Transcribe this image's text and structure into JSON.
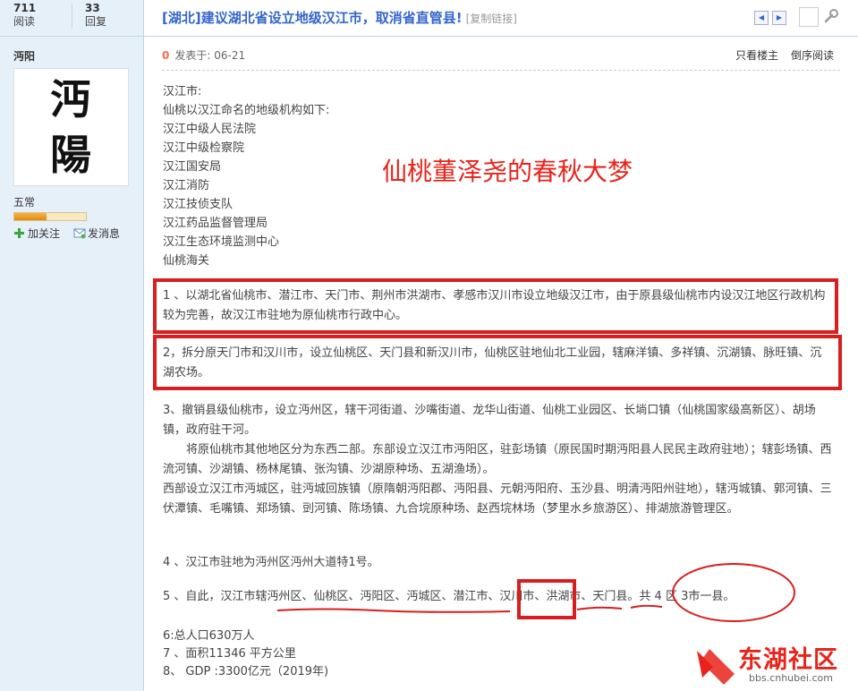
{
  "stats": {
    "views_num": "711",
    "views_label": "阅读",
    "replies_num": "33",
    "replies_label": "回复"
  },
  "author": {
    "name": "沔阳",
    "rank": "五常",
    "rank_progress": 0.45,
    "follow_label": "加关注",
    "message_label": "发消息"
  },
  "thread": {
    "title": "[湖北]建议湖北省设立地级汉江市，取消省直管县!",
    "copy_link": "[复制链接]"
  },
  "post": {
    "floor": "0",
    "posted": "发表于: 06-21",
    "only_op": "只看楼主",
    "reverse": "倒序阅读"
  },
  "intro_lines": [
    "汉江市:",
    "仙桃以汉江命名的地级机构如下:",
    "汉江中级人民法院",
    "汉江中级检察院",
    "汉江国安局",
    "汉江消防",
    "汉江技侦支队",
    "汉江药品监督管理局",
    "汉江生态环境监测中心",
    "仙桃海关"
  ],
  "overlay_title": "仙桃董泽尧的春秋大梦",
  "paragraphs": {
    "p1": "1 、以湖北省仙桃市、潜江市、天门市、荆州市洪湖市、孝感市汉川市设立地级汉江市，由于原县级仙桃市内设汉江地区行政机构较为完善，故汉江市驻地为原仙桃市行政中心。",
    "p2": "2，拆分原天门市和汉川市，设立仙桃区、天门县和新汉川市，仙桃区驻地仙北工业园，辖麻洋镇、多祥镇、沉湖镇、脉旺镇、沉湖农场。",
    "p3a": "3、撤销县级仙桃市，设立沔州区，辖干河街道、沙嘴街道、龙华山街道、仙桃工业园区、长埫口镇（仙桃国家级高新区）、胡场镇，政府驻干河。",
    "p3b": "将原仙桃市其他地区分为东西二部。东部设立汉江市沔阳区，驻彭场镇（原民国时期沔阳县人民民主政府驻地）；辖彭场镇、西流河镇、沙湖镇、杨林尾镇、张沟镇、沙湖原种场、五湖渔场）。",
    "p3c": "西部设立汉江市沔城区，驻沔城回族镇（原隋朝沔阳郡、沔阳县、元朝沔阳府、玉沙县、明清沔阳州驻地），辖沔城镇、郭河镇、三伏潭镇、毛嘴镇、郑场镇、剅河镇、陈场镇、九合垸原种场、赵西垸林场（梦里水乡旅游区）、排湖旅游管理区。",
    "p4": "4 、汉江市驻地为沔州区沔州大道特1号。",
    "p5": "5 、自此，汉江市辖沔州区、仙桃区、沔阳区、沔城区、潜江市、汉川市、洪湖市、天门县。共 4 区 3市一县。",
    "p6": "6:总人口630万人",
    "p7": "7 、面积11346 平方公里",
    "p8": "8、 GDP :3300亿元（2019年)"
  },
  "watermark": {
    "brand": "东湖社区",
    "url": "bbs.cnhubei.com"
  },
  "colors": {
    "link": "#3366cc",
    "annotation_red": "#d81e1e",
    "sidebar_bg": "#e6f0f9"
  }
}
